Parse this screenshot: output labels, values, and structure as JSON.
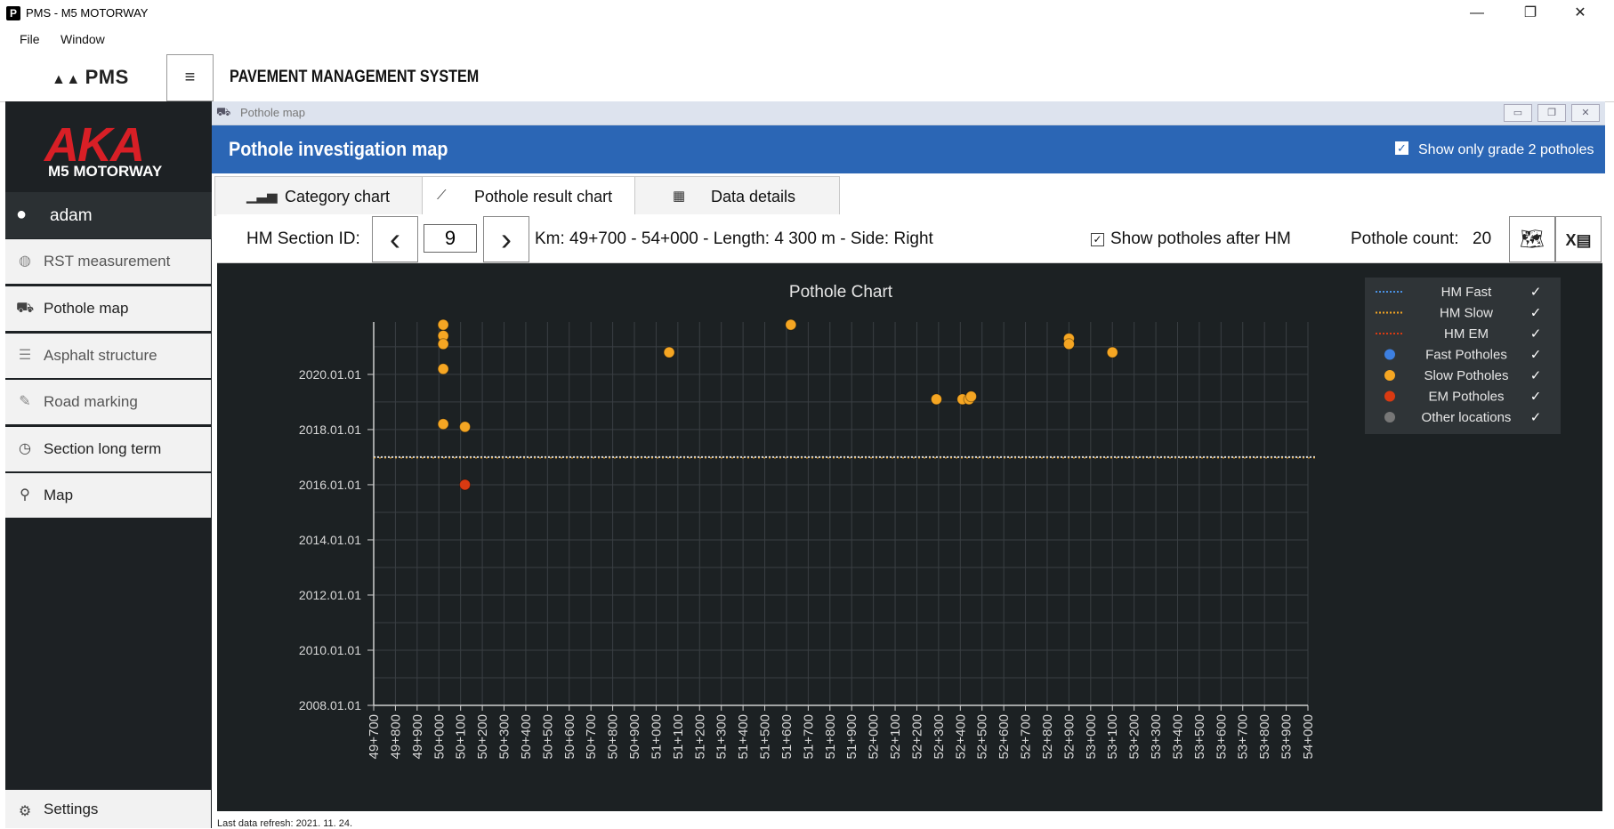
{
  "window": {
    "title": "PMS - M5 MOTORWAY",
    "app_icon": "P",
    "minimize": "—",
    "restore": "❐",
    "close": "✕"
  },
  "menu": [
    "File",
    "Window"
  ],
  "header": {
    "logo": "PMS",
    "hamburger": "≡",
    "title": "PAVEMENT MANAGEMENT SYSTEM"
  },
  "sidebar": {
    "logo": "AKA",
    "logo_sub": "M5 MOTORWAY",
    "user": "adam",
    "items": [
      {
        "label": "RST measurement",
        "icon": "gauge-icon"
      },
      {
        "label": "Pothole map",
        "icon": "car-icon"
      },
      {
        "label": "Asphalt structure",
        "icon": "layers-icon"
      },
      {
        "label": "Road marking",
        "icon": "pen-icon"
      },
      {
        "label": "Section long term",
        "icon": "clock-icon"
      },
      {
        "label": "Map",
        "icon": "map-pin-icon"
      }
    ],
    "settings": "Settings"
  },
  "inner_window": {
    "title": "Pothole map",
    "heading": "Pothole investigation map",
    "grade_checkbox": "Show only grade 2 potholes",
    "grade_checked": true
  },
  "tabs": [
    {
      "label": "Category chart",
      "icon": "bar-chart-icon"
    },
    {
      "label": "Pothole result chart",
      "icon": "line-chart-icon",
      "active": true
    },
    {
      "label": "Data details",
      "icon": "grid-icon"
    }
  ],
  "toolbar": {
    "hm_label": "HM Section ID:",
    "hm_value": "9",
    "prev": "‹",
    "next": "›",
    "km_text": "Km: 49+700  -  54+000  -  Length: 4 300 m   - Side: Right",
    "after_hm_label": "Show potholes after HM",
    "after_hm_checked": true,
    "count_label": "Pothole count:",
    "count_value": "20"
  },
  "chart_data": {
    "type": "scatter",
    "title": "Pothole Chart",
    "x_ticks": [
      "49+700",
      "49+800",
      "49+900",
      "50+000",
      "50+100",
      "50+200",
      "50+300",
      "50+400",
      "50+500",
      "50+600",
      "50+700",
      "50+800",
      "50+900",
      "51+000",
      "51+100",
      "51+200",
      "51+300",
      "51+400",
      "51+500",
      "51+600",
      "51+700",
      "51+800",
      "51+900",
      "52+000",
      "52+100",
      "52+200",
      "52+300",
      "52+400",
      "52+500",
      "52+600",
      "52+700",
      "52+800",
      "52+900",
      "53+000",
      "53+100",
      "53+200",
      "53+300",
      "53+400",
      "53+500",
      "53+600",
      "53+700",
      "53+800",
      "53+900",
      "54+000"
    ],
    "y_ticks": [
      "2008.01.01",
      "2010.01.01",
      "2012.01.01",
      "2014.01.01",
      "2016.01.01",
      "2018.01.01",
      "2020.01.01"
    ],
    "xlim": [
      49700,
      54000
    ],
    "ylim": [
      2008.0,
      2021.9
    ],
    "grid": true,
    "hm_line_year": 2017.0,
    "series": [
      {
        "name": "Slow Potholes",
        "color": "#f5a623",
        "points": [
          [
            50020,
            2021.8
          ],
          [
            50020,
            2021.4
          ],
          [
            50020,
            2021.1
          ],
          [
            50020,
            2020.2
          ],
          [
            50020,
            2018.2
          ],
          [
            50120,
            2018.1
          ],
          [
            51060,
            2020.8
          ],
          [
            51620,
            2021.8
          ],
          [
            52290,
            2019.1
          ],
          [
            52410,
            2019.1
          ],
          [
            52440,
            2019.1
          ],
          [
            52450,
            2019.2
          ],
          [
            52900,
            2021.3
          ],
          [
            52900,
            2021.1
          ],
          [
            53100,
            2020.8
          ]
        ]
      },
      {
        "name": "EM Potholes",
        "color": "#d93a12",
        "points": [
          [
            50120,
            2016.0
          ]
        ]
      }
    ],
    "legend": [
      {
        "label": "HM Fast",
        "kind": "line",
        "color": "#4a90e2",
        "check": "✓"
      },
      {
        "label": "HM Slow",
        "kind": "line",
        "color": "#f5a623",
        "check": "✓"
      },
      {
        "label": "HM EM",
        "kind": "line",
        "color": "#d93a12",
        "check": "✓"
      },
      {
        "label": "Fast Potholes",
        "kind": "dot",
        "color": "#3d7fe0",
        "check": "✓"
      },
      {
        "label": "Slow Potholes",
        "kind": "dot",
        "color": "#f5a623",
        "check": "✓"
      },
      {
        "label": "EM Potholes",
        "kind": "dot",
        "color": "#d93a12",
        "check": "✓"
      },
      {
        "label": "Other locations",
        "kind": "dot",
        "color": "#777777",
        "check": "✓"
      }
    ],
    "legend_position": "top-right"
  },
  "status": "Last data refresh:  2021. 11. 24."
}
